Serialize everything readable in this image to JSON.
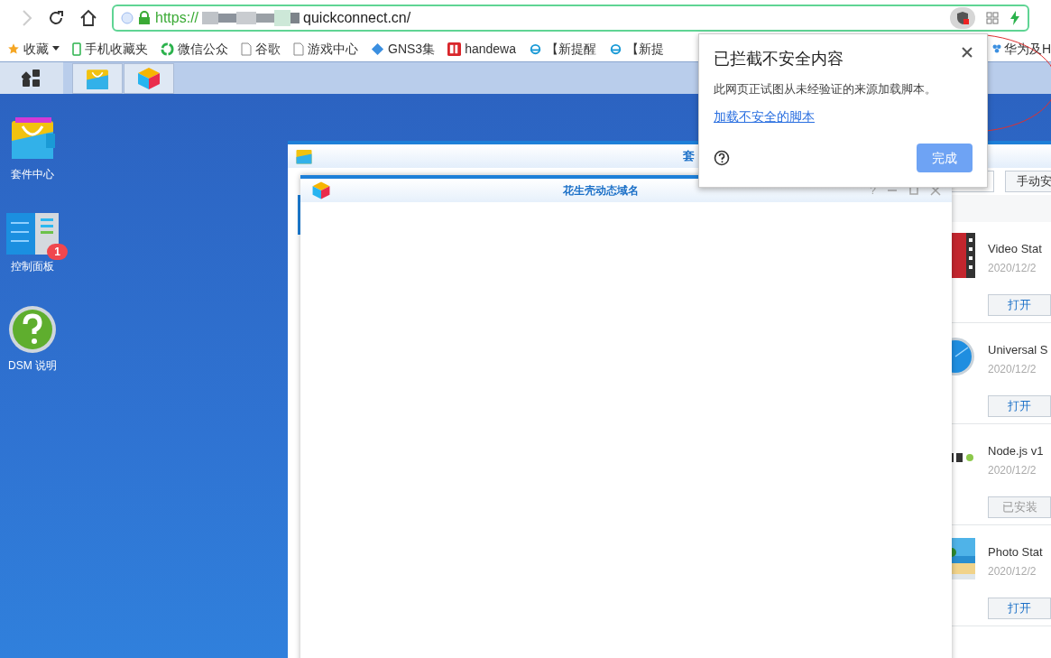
{
  "browser": {
    "url_scheme": "https://",
    "url_host": "quickconnect.cn/"
  },
  "bookmarks": [
    {
      "label": "收藏",
      "kind": "star"
    },
    {
      "label": "手机收藏夹",
      "kind": "phone"
    },
    {
      "label": "微信公众",
      "kind": "wechat"
    },
    {
      "label": "谷歌",
      "kind": "page"
    },
    {
      "label": "游戏中心",
      "kind": "page"
    },
    {
      "label": "GNS3集",
      "kind": "gem"
    },
    {
      "label": "handewa",
      "kind": "fiftyone"
    },
    {
      "label": "【新提醒",
      "kind": "ie"
    },
    {
      "label": "【新提",
      "kind": "ie"
    },
    {
      "label": "华为及H",
      "kind": "flower"
    }
  ],
  "desktop_icons": [
    {
      "label": "套件中心",
      "kind": "package"
    },
    {
      "label": "控制面板",
      "kind": "panel",
      "badge": "1"
    },
    {
      "label": "DSM 说明",
      "kind": "help"
    }
  ],
  "back_window": {
    "title": "套",
    "action_button": "手动安"
  },
  "packages": [
    {
      "name": "Video Stat",
      "date": "2020/12/2",
      "button": "打开",
      "disabled": false,
      "kind": "video"
    },
    {
      "name": "Universal S",
      "date": "2020/12/2",
      "button": "打开",
      "disabled": false,
      "kind": "globe"
    },
    {
      "name": "Node.js v1",
      "date": "2020/12/2",
      "button": "已安装",
      "disabled": true,
      "kind": "node"
    },
    {
      "name": "Photo Stat",
      "date": "2020/12/2",
      "button": "打开",
      "disabled": false,
      "kind": "photo"
    }
  ],
  "front_window": {
    "title": "花生壳动态域名",
    "controls": [
      "?"
    ]
  },
  "popup": {
    "title": "已拦截不安全内容",
    "body": "此网页正试图从未经验证的来源加载脚本。",
    "link": "加载不安全的脚本",
    "button": "完成"
  }
}
